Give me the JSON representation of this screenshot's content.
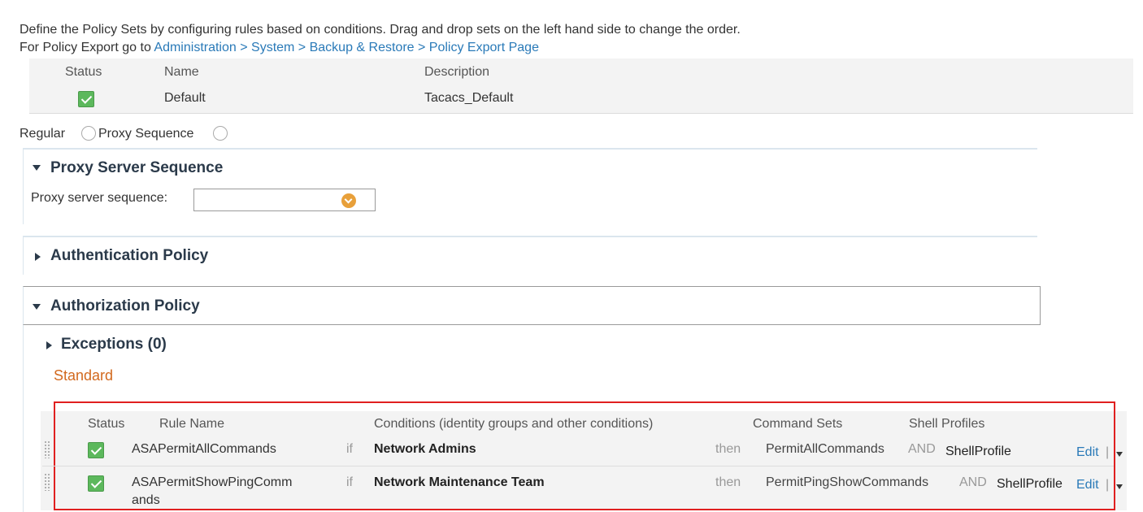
{
  "intro": {
    "line1": "Define the Policy Sets by configuring rules based on conditions. Drag and drop sets on the left hand side to change the order.",
    "line2_prefix": "For Policy Export go to ",
    "line2_link": "Administration > System > Backup & Restore > Policy Export Page"
  },
  "policy_set": {
    "headers": {
      "status": "Status",
      "name": "Name",
      "description": "Description"
    },
    "row": {
      "name": "Default",
      "description": "Tacacs_Default"
    }
  },
  "mode": {
    "regular_label": "Regular",
    "proxy_label": "Proxy Sequence"
  },
  "proxy_section": {
    "title": "Proxy Server Sequence",
    "field_label": "Proxy server sequence:",
    "field_value": ""
  },
  "authentication": {
    "title": "Authentication Policy"
  },
  "authorization": {
    "title": "Authorization Policy",
    "exceptions": "Exceptions (0)",
    "standard": "Standard",
    "headers": {
      "status": "Status",
      "rule_name": "Rule Name",
      "conditions": "Conditions (identity groups and other conditions)",
      "command_sets": "Command Sets",
      "shell_profiles": "Shell Profiles"
    },
    "rules": [
      {
        "name": "ASAPermitAllCommands",
        "if": "if",
        "condition": "Network Admins",
        "then": "then",
        "command_set": "PermitAllCommands",
        "and": "AND",
        "shell_profile": "ShellProfile",
        "edit": "Edit"
      },
      {
        "name_line1": "ASAPermitShowPingComm",
        "name_line2": "ands",
        "if": "if",
        "condition": "Network Maintenance Team",
        "then": "then",
        "command_set": "PermitPingShowCommands",
        "and": "AND",
        "shell_profile": "ShellProfile",
        "edit": "Edit"
      }
    ]
  },
  "colors": {
    "accent_link": "#2a7ab8",
    "check_green": "#5cb85c",
    "standard_orange": "#d2691e",
    "highlight_red": "#e02020"
  }
}
